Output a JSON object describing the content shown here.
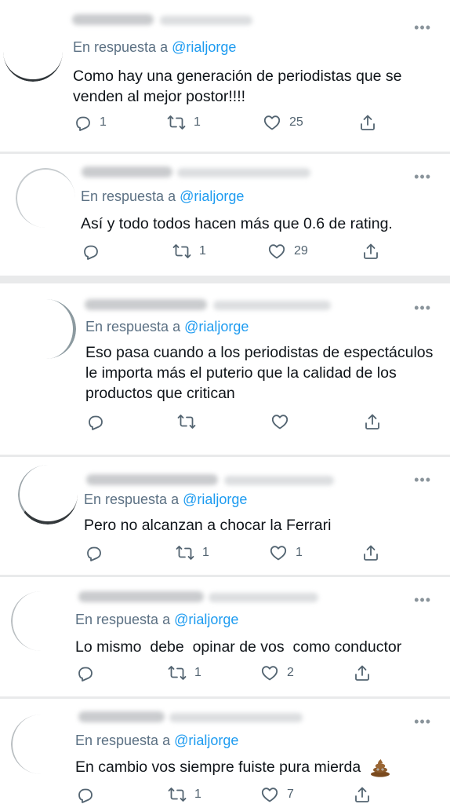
{
  "reply_prefix": "En respuesta a",
  "more_label": "•••",
  "colors": {
    "link": "#1d9bf0",
    "secondary": "#5b7083",
    "text": "#0f1419",
    "divider": "#e9eaeb"
  },
  "icons": {
    "reply": "reply-icon",
    "retweet": "retweet-icon",
    "like": "heart-icon",
    "share": "share-icon",
    "more": "more-icon"
  },
  "tweets": [
    {
      "handle": "@rialjorge",
      "text": "Como hay una generación de periodistas que se venden al mejor postor!!!!",
      "replies": "1",
      "retweets": "1",
      "likes": "25"
    },
    {
      "handle": "@rialjorge",
      "text": "Así y todo todos hacen más que 0.6 de rating.",
      "replies": "",
      "retweets": "1",
      "likes": "29"
    },
    {
      "handle": "@rialjorge",
      "text": "Eso pasa cuando a los periodistas de espectáculos le importa más el puterio que la calidad de los productos que critican",
      "replies": "",
      "retweets": "",
      "likes": ""
    },
    {
      "handle": "@rialjorge",
      "text": "Pero no alcanzan a chocar la Ferrari",
      "replies": "",
      "retweets": "1",
      "likes": "1"
    },
    {
      "handle": "@rialjorge",
      "text": "Lo mismo  debe  opinar de vos  como conductor",
      "replies": "",
      "retweets": "1",
      "likes": "2"
    },
    {
      "handle": "@rialjorge",
      "text": "En cambio vos siempre fuiste pura mierda",
      "emoji": "pile-of-poo-emoji",
      "replies": "",
      "retweets": "1",
      "likes": "7"
    }
  ]
}
